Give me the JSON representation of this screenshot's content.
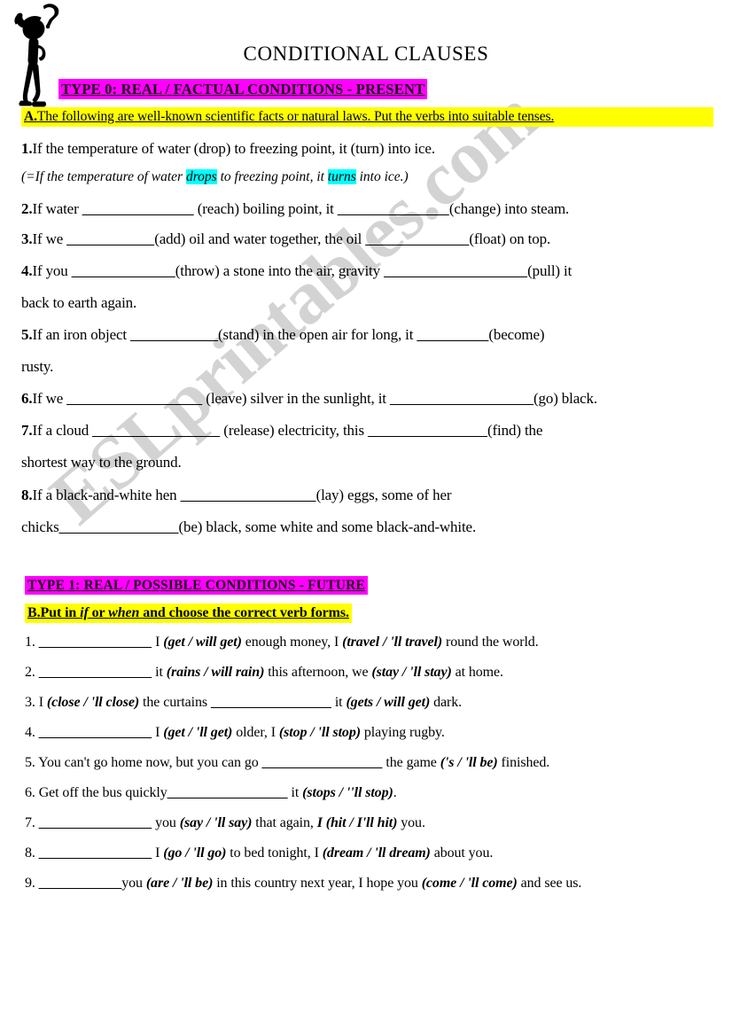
{
  "document": {
    "title": "CONDITIONAL CLAUSES",
    "watermark": "ESLprintables.com"
  },
  "colors": {
    "magenta_highlight": "#ff00ff",
    "yellow_highlight": "#ffff00",
    "cyan_highlight": "#00ffff",
    "text": "#000000",
    "watermark": "#c9c9c9",
    "background": "#ffffff"
  },
  "icon": {
    "name": "thinking-stick-figure-icon",
    "question_mark": "?"
  },
  "section_a": {
    "type_header": "TYPE 0:  REAL / FACTUAL CONDITIONS - PRESENT",
    "instruction_letter": "A.",
    "instruction_text": "The following are well-known scientific facts or natural laws. Put the verbs into suitable tenses.",
    "items": [
      {
        "number": "1.",
        "text": "If the temperature of water (drop) to freezing point, it (turn) into ice."
      },
      {
        "number": "2.",
        "pre": "If water ",
        "blank1": "______________",
        "mid": " (reach) boiling point, it ",
        "blank2": "______________",
        "post": "(change) into steam."
      },
      {
        "number": "3.",
        "pre": "If we ",
        "blank1": "___________",
        "mid": "(add) oil and water together, the oil ",
        "blank2": "_____________",
        "post": "(float) on top."
      },
      {
        "number": "4.",
        "pre": "If you ",
        "blank1": "_____________",
        "mid": "(throw) a stone into the air, gravity ",
        "blank2": "__________________",
        "post": "(pull) it"
      },
      {
        "number": "",
        "continuation": "back to earth again."
      },
      {
        "number": "5.",
        "pre": "If an iron object ",
        "blank1": "___________",
        "mid": "(stand) in the open air for long, it ",
        "blank2": "_________",
        "post": "(become)"
      },
      {
        "number": "",
        "continuation": "rusty."
      },
      {
        "number": "6.",
        "pre": "If we ",
        "blank1": "_________________",
        "mid": " (leave) silver in the sunlight, it ",
        "blank2": "__________________",
        "post": "(go) black."
      },
      {
        "number": "7.",
        "pre": "If a cloud ",
        "blank1": "________________",
        "mid": " (release) electricity, this ",
        "blank2": "_______________",
        "post": "(find) the"
      },
      {
        "number": "",
        "continuation": "shortest way to the ground."
      },
      {
        "number": "8.",
        "pre": "If a black-and-white hen ",
        "blank1": "_________________",
        "mid": "",
        "blank2": "",
        "post": "(lay) eggs, some of her"
      },
      {
        "number": "",
        "continuation_pre": "chicks",
        "continuation_blank": "_______________",
        "continuation_post": "(be) black, some white and some black-and-white."
      }
    ],
    "answer_example": {
      "prefix": "(=If the temperature of water ",
      "highlight1": "drops",
      "middle": " to freezing point, it ",
      "highlight2": "turns",
      "suffix": " into ice.)"
    }
  },
  "section_b": {
    "type_header": "TYPE 1: REAL / POSSIBLE CONDITIONS - FUTURE",
    "instruction_letter": "B.",
    "instruction_pre": "Put in ",
    "instruction_word1": "if",
    "instruction_mid": " or ",
    "instruction_word2": "when",
    "instruction_post": " and choose the correct verb forms.",
    "items": [
      {
        "number": "1.",
        "blank": "_______________",
        "pre": " I ",
        "choice1": "(get / will get)",
        "mid": " enough money, I ",
        "choice2": "(travel / 'll travel)",
        "post": " round the world."
      },
      {
        "number": "2.",
        "blank": "_______________",
        "pre": " it ",
        "choice1": "(rains / will rain)",
        "mid": " this afternoon, we ",
        "choice2": "(stay / 'll stay)",
        "post": " at home."
      },
      {
        "number": "3.",
        "blank": "",
        "pre": " I ",
        "choice1": "(close / 'll close)",
        "mid": " the curtains ",
        "blank2": "________________",
        "mid2": " it ",
        "choice2": "(gets / will get)",
        "post": " dark."
      },
      {
        "number": "4.",
        "blank": "_______________",
        "pre": " I ",
        "choice1": "(get / 'll get)",
        "mid": " older, I ",
        "choice2": "(stop / 'll stop)",
        "post": " playing rugby."
      },
      {
        "number": "5.",
        "blank": "",
        "pre": " You can't go home now, but you can go ",
        "blank2": "________________",
        "mid2": " the game ",
        "choice2": "('s / 'll be)",
        "post": " finished."
      },
      {
        "number": "6.",
        "blank": "",
        "pre": " Get off the bus quickly",
        "blank2": "________________",
        "mid2": " it ",
        "choice2": "(stops / ''ll stop)",
        "post": "."
      },
      {
        "number": "7.",
        "blank": "_______________",
        "pre": " you ",
        "choice1": "(say / 'll say)",
        "mid": " that again, ",
        "choice2": "I (hit / I'll hit)",
        "post": " you."
      },
      {
        "number": "8.",
        "blank": "_______________",
        "pre": " I ",
        "choice1": "(go / 'll go)",
        "mid": " to bed tonight, I ",
        "choice2": "(dream / 'll dream)",
        "post": " about you."
      },
      {
        "number": "9.",
        "blank": "___________",
        "pre": "you ",
        "choice1": "(are / 'll be)",
        "mid": " in this country next year, I hope you ",
        "choice2": "(come / 'll come)",
        "post": " and see us."
      }
    ]
  }
}
